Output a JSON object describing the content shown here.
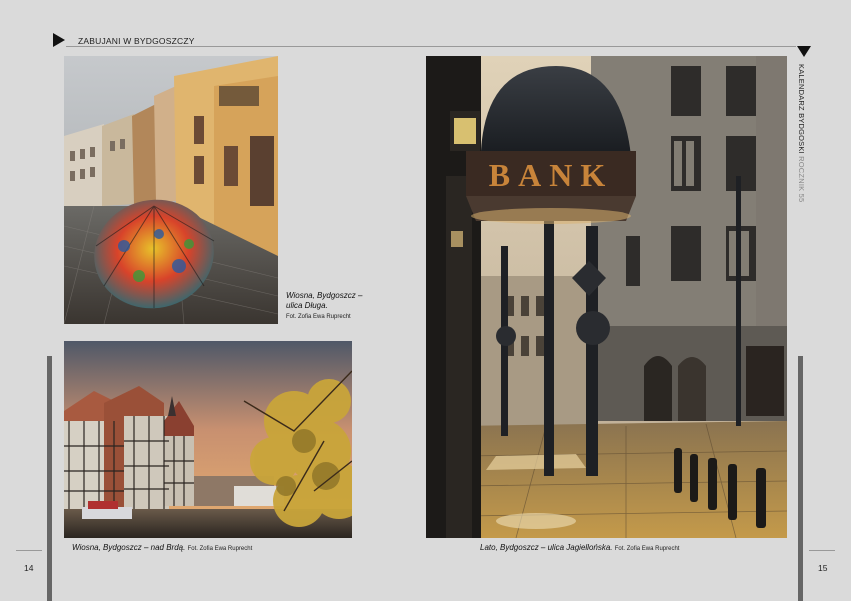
{
  "header": {
    "section_title": "ZABUJANI W BYDGOSZCZY",
    "side_title_main": "KALENDARZ BYDGOSKI",
    "side_title_sub": " ROCZNIK 55"
  },
  "captions": {
    "photo1_title": "Wiosna, Bydgoszcz –\nulica Długa.",
    "photo1_credit": "Fot. Zofia Ewa Ruprecht",
    "photo2_title": "Wiosna, Bydgoszcz – nad Brdą.",
    "photo2_credit": "Fot. Zofia Ewa Ruprecht",
    "photo3_title": "Lato, Bydgoszcz – ulica Jagiellońska.",
    "photo3_credit": "Fot. Zofia Ewa Ruprecht"
  },
  "photo3_sign_text": "BANK",
  "folios": {
    "left": "14",
    "right": "15"
  }
}
